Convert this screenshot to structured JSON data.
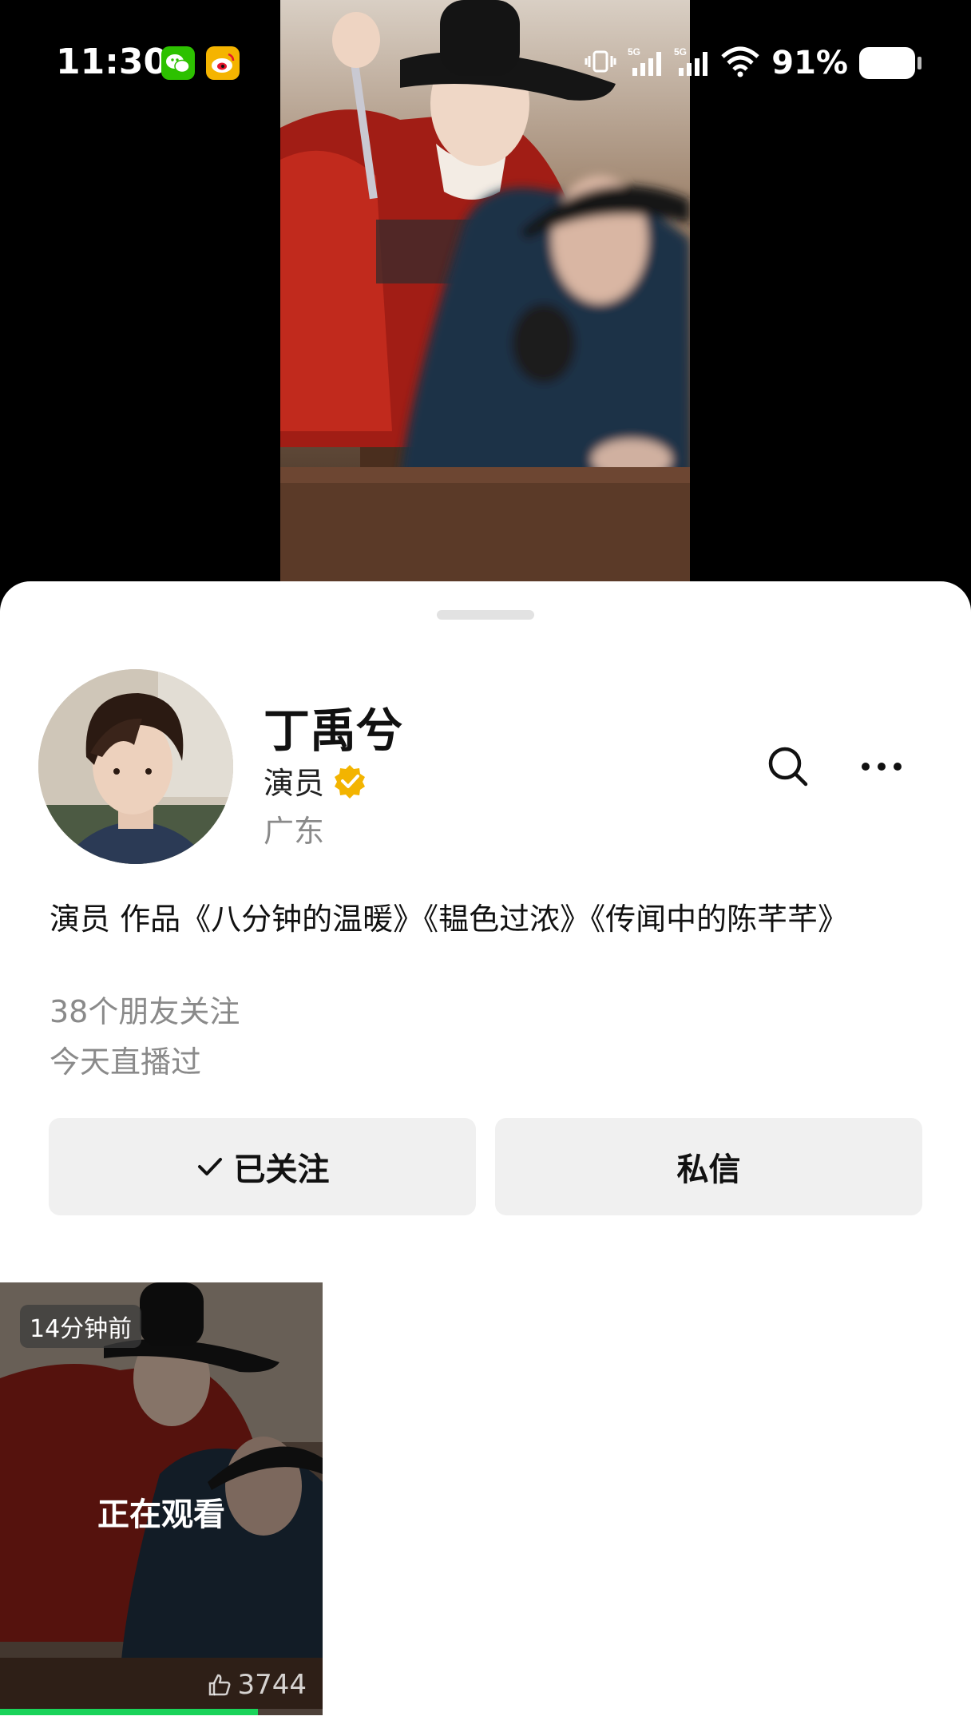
{
  "status_bar": {
    "time": "11:30",
    "battery_text": "91%",
    "app_icons": [
      "wechat-icon",
      "weibo-icon"
    ],
    "signal_icons": [
      "vibrate-icon",
      "signal-5g-icon",
      "signal-5g-icon",
      "wifi-icon",
      "battery-icon"
    ]
  },
  "profile": {
    "name": "丁禹兮",
    "title": "演员",
    "region": "广东",
    "bio": "演员 作品《八分钟的温暖》《韫色过浓》《传闻中的陈芊芊》",
    "friends_follow": "38个朋友关注",
    "live_status": "今天直播过",
    "verified_color": "#f3b400"
  },
  "actions": {
    "follow_label": "已关注",
    "message_label": "私信"
  },
  "feed": {
    "items": [
      {
        "time_badge": "14分钟前",
        "watching_label": "正在观看",
        "likes": "3744",
        "progress": 0.8
      }
    ]
  },
  "colors": {
    "progress": "#1ad35a",
    "verified": "#f3b400"
  }
}
